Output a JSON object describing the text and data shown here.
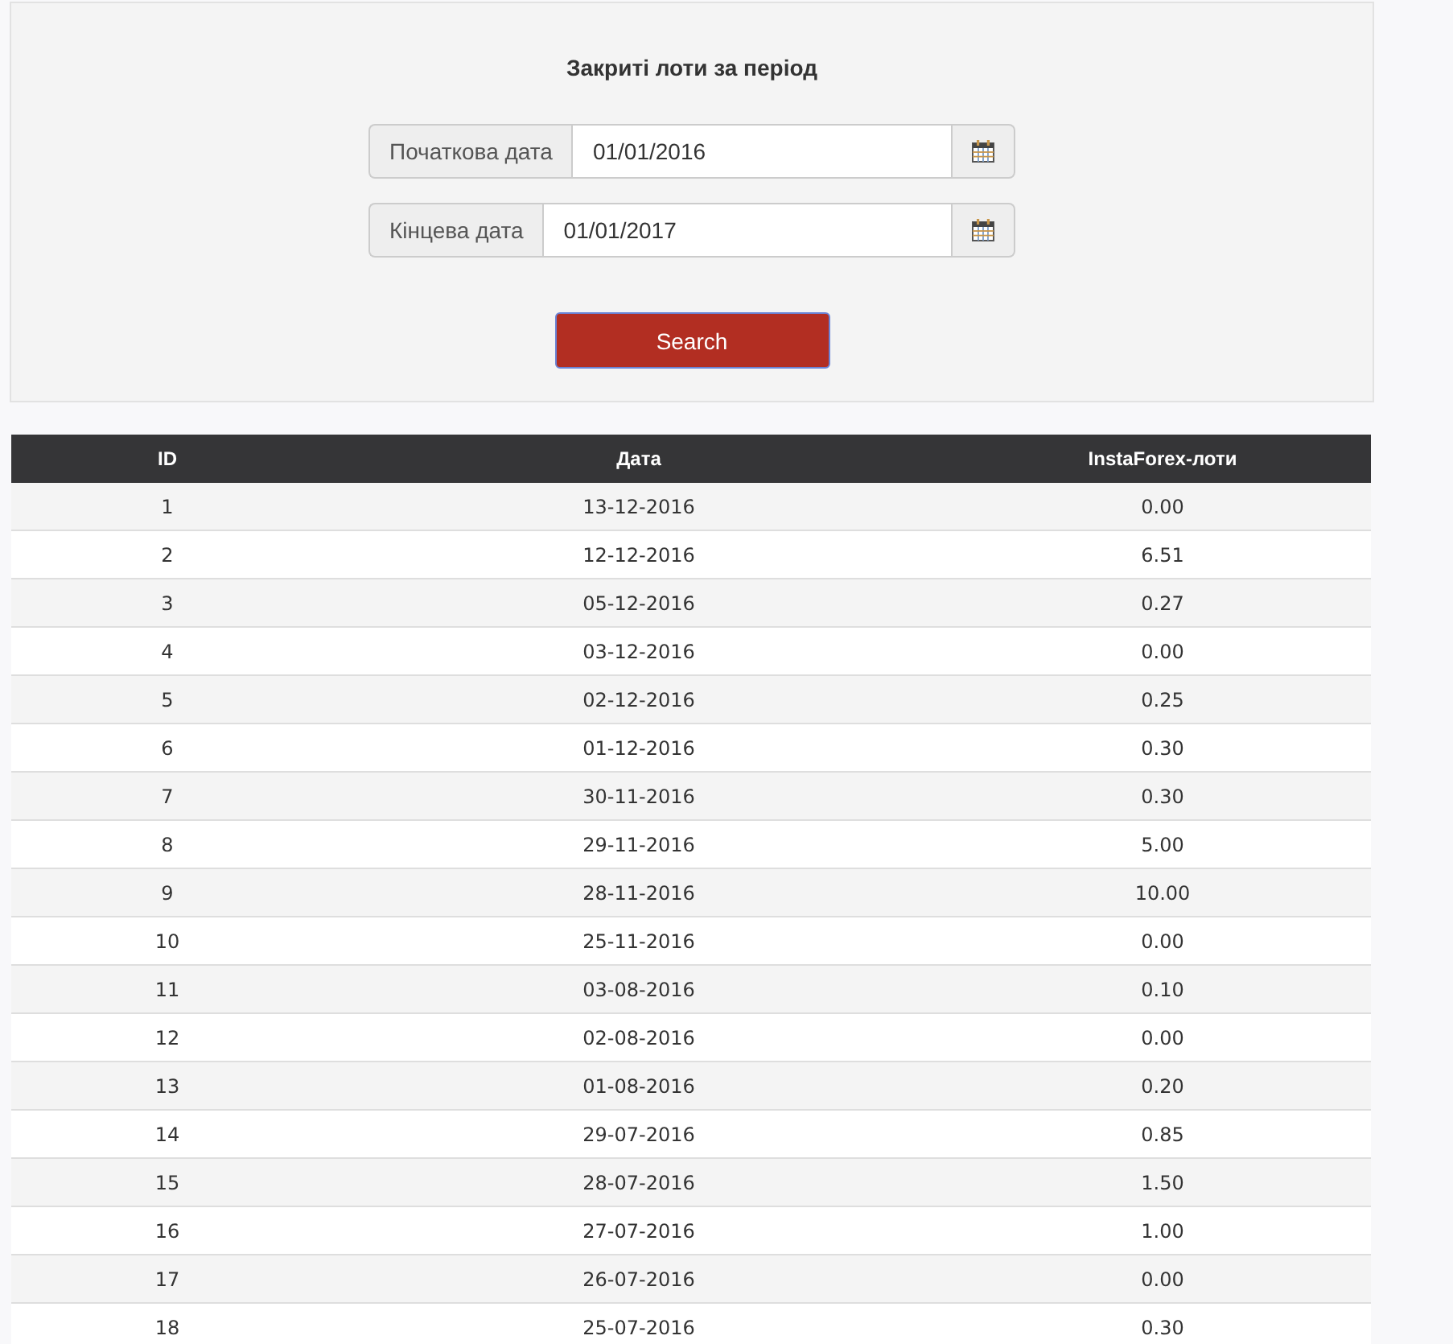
{
  "filter_panel": {
    "title": "Закриті лоти за період",
    "date_fields": [
      {
        "label": "Початкова дата",
        "value": "01/01/2016"
      },
      {
        "label": "Кінцева дата",
        "value": "01/01/2017"
      }
    ],
    "search_button": {
      "label": "Search",
      "focused": true
    }
  },
  "table": {
    "columns": [
      "ID",
      "Дата",
      "InstaForex-лоти"
    ],
    "rows": [
      [
        "1",
        "13-12-2016",
        "0.00"
      ],
      [
        "2",
        "12-12-2016",
        "6.51"
      ],
      [
        "3",
        "05-12-2016",
        "0.27"
      ],
      [
        "4",
        "03-12-2016",
        "0.00"
      ],
      [
        "5",
        "02-12-2016",
        "0.25"
      ],
      [
        "6",
        "01-12-2016",
        "0.30"
      ],
      [
        "7",
        "30-11-2016",
        "0.30"
      ],
      [
        "8",
        "29-11-2016",
        "5.00"
      ],
      [
        "9",
        "28-11-2016",
        "10.00"
      ],
      [
        "10",
        "25-11-2016",
        "0.00"
      ],
      [
        "11",
        "03-08-2016",
        "0.10"
      ],
      [
        "12",
        "02-08-2016",
        "0.00"
      ],
      [
        "13",
        "01-08-2016",
        "0.20"
      ],
      [
        "14",
        "29-07-2016",
        "0.85"
      ],
      [
        "15",
        "28-07-2016",
        "1.50"
      ],
      [
        "16",
        "27-07-2016",
        "1.00"
      ],
      [
        "17",
        "26-07-2016",
        "0.00"
      ],
      [
        "18",
        "25-07-2016",
        "0.30"
      ]
    ]
  }
}
